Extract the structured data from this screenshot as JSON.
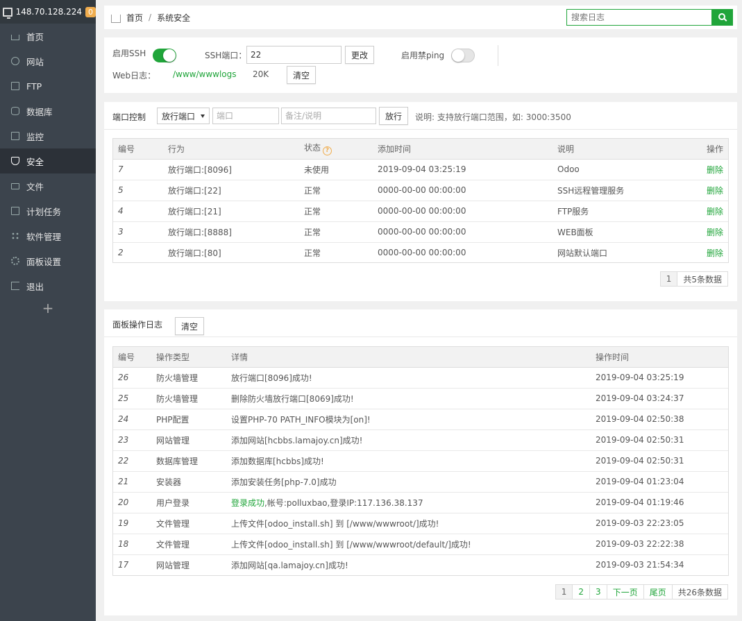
{
  "sidebar": {
    "ip": "148.70.128.224",
    "badge": "0",
    "items": [
      {
        "label": "首页"
      },
      {
        "label": "网站"
      },
      {
        "label": "FTP"
      },
      {
        "label": "数据库"
      },
      {
        "label": "监控"
      },
      {
        "label": "安全"
      },
      {
        "label": "文件"
      },
      {
        "label": "计划任务"
      },
      {
        "label": "软件管理"
      },
      {
        "label": "面板设置"
      },
      {
        "label": "退出"
      }
    ],
    "add": "+"
  },
  "breadcrumb": {
    "home": "首页",
    "sep": "/",
    "current": "系统安全"
  },
  "search": {
    "placeholder": "搜索日志"
  },
  "ssh": {
    "enable_label": "启用SSH",
    "ssh_enabled": true,
    "port_label": "SSH端口：",
    "port_value": "22",
    "change_btn": "更改",
    "ping_label": "启用禁ping",
    "ping_enabled": false,
    "weblog_label": "Web日志：",
    "weblog_path": "/www/wwwlogs",
    "weblog_size": "20K",
    "clear_btn": "清空"
  },
  "port_control": {
    "title": "端口控制",
    "select_value": "放行端口",
    "port_placeholder": "端口",
    "note_placeholder": "备注/说明",
    "allow_btn": "放行",
    "hint": "说明: 支持放行端口范围，如: 3000:3500",
    "columns": [
      "编号",
      "行为",
      "状态",
      "添加时间",
      "说明",
      "操作"
    ],
    "rows": [
      {
        "id": "7",
        "action": "放行端口:[8096]",
        "status": "未使用",
        "time": "2019-09-04 03:25:19",
        "desc": "Odoo",
        "op": "删除"
      },
      {
        "id": "5",
        "action": "放行端口:[22]",
        "status": "正常",
        "time": "0000-00-00 00:00:00",
        "desc": "SSH远程管理服务",
        "op": "删除"
      },
      {
        "id": "4",
        "action": "放行端口:[21]",
        "status": "正常",
        "time": "0000-00-00 00:00:00",
        "desc": "FTP服务",
        "op": "删除"
      },
      {
        "id": "3",
        "action": "放行端口:[8888]",
        "status": "正常",
        "time": "0000-00-00 00:00:00",
        "desc": "WEB面板",
        "op": "删除"
      },
      {
        "id": "2",
        "action": "放行端口:[80]",
        "status": "正常",
        "time": "0000-00-00 00:00:00",
        "desc": "网站默认端口",
        "op": "删除"
      }
    ],
    "pager": {
      "page": "1",
      "total": "共5条数据"
    }
  },
  "log": {
    "title": "面板操作日志",
    "clear_btn": "清空",
    "columns": [
      "编号",
      "操作类型",
      "详情",
      "操作时间"
    ],
    "rows": [
      {
        "id": "26",
        "type": "防火墙管理",
        "detail": "放行端口[8096]成功!",
        "detail_green": "",
        "time": "2019-09-04 03:25:19"
      },
      {
        "id": "25",
        "type": "防火墙管理",
        "detail": "删除防火墙放行端口[8069]成功!",
        "detail_green": "",
        "time": "2019-09-04 03:24:37"
      },
      {
        "id": "24",
        "type": "PHP配置",
        "detail": "设置PHP-70 PATH_INFO模块为[on]!",
        "detail_green": "",
        "time": "2019-09-04 02:50:38"
      },
      {
        "id": "23",
        "type": "网站管理",
        "detail": "添加网站[hcbbs.lamajoy.cn]成功!",
        "detail_green": "",
        "time": "2019-09-04 02:50:31"
      },
      {
        "id": "22",
        "type": "数据库管理",
        "detail": "添加数据库[hcbbs]成功!",
        "detail_green": "",
        "time": "2019-09-04 02:50:31"
      },
      {
        "id": "21",
        "type": "安装器",
        "detail": "添加安装任务[php-7.0]成功",
        "detail_green": "",
        "time": "2019-09-04 01:23:04"
      },
      {
        "id": "20",
        "type": "用户登录",
        "detail": ",帐号:polluxbao,登录IP:117.136.38.137",
        "detail_green": "登录成功",
        "time": "2019-09-04 01:19:46"
      },
      {
        "id": "19",
        "type": "文件管理",
        "detail": "上传文件[odoo_install.sh] 到 [/www/wwwroot/]成功!",
        "detail_green": "",
        "time": "2019-09-03 22:23:05"
      },
      {
        "id": "18",
        "type": "文件管理",
        "detail": "上传文件[odoo_install.sh] 到 [/www/wwwroot/default/]成功!",
        "detail_green": "",
        "time": "2019-09-03 22:22:38"
      },
      {
        "id": "17",
        "type": "网站管理",
        "detail": "添加网站[qa.lamajoy.cn]成功!",
        "detail_green": "",
        "time": "2019-09-03 21:54:34"
      }
    ],
    "pager": {
      "pages": [
        "1",
        "2",
        "3"
      ],
      "next": "下一页",
      "last": "尾页",
      "total": "共26条数据"
    }
  },
  "colors": {
    "accent": "#20a53a",
    "sidebar": "#3c444d",
    "badge": "#f0ad4e"
  }
}
